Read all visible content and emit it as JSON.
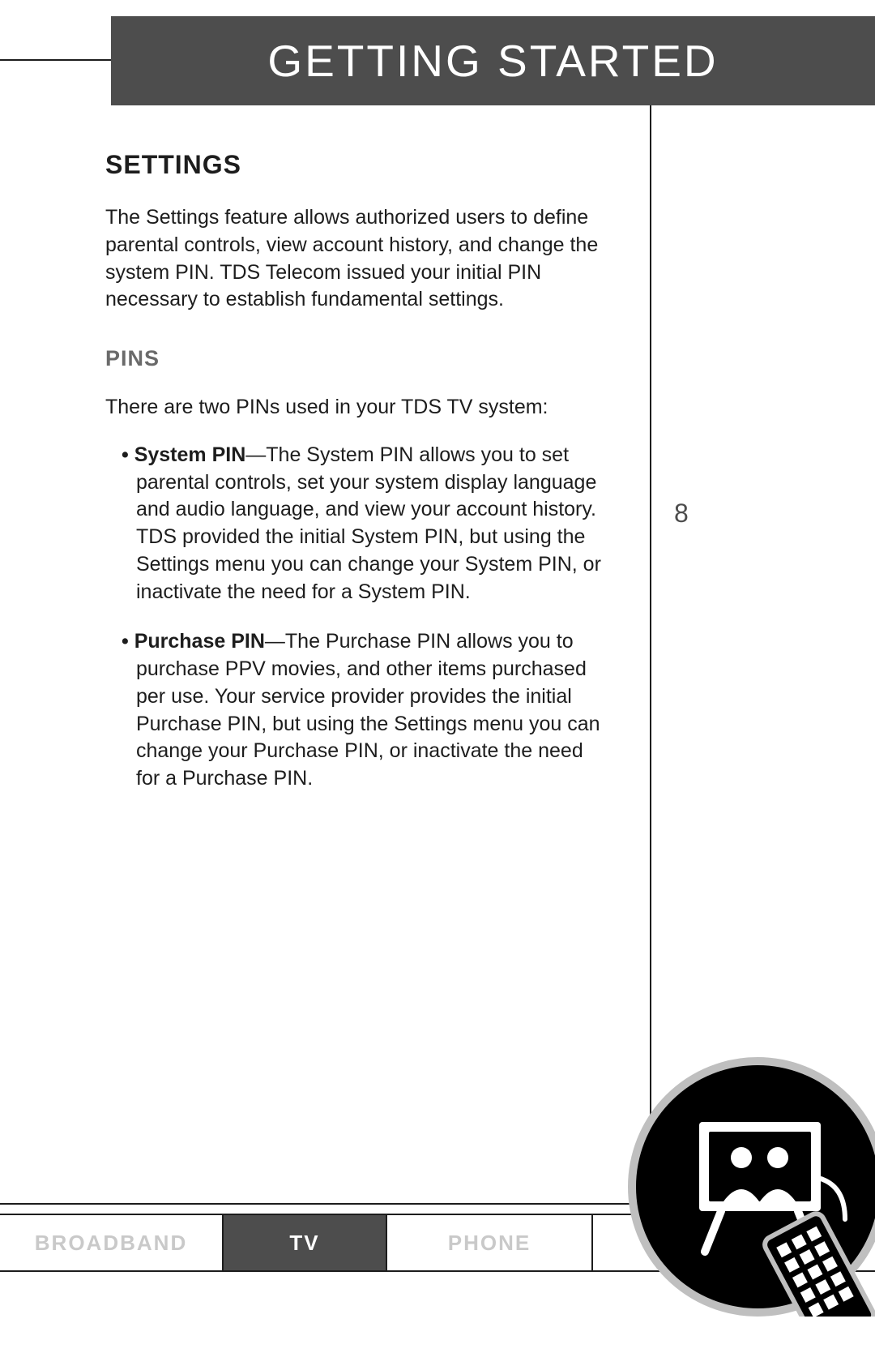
{
  "header": {
    "title": "GETTING STARTED"
  },
  "page_number": "8",
  "content": {
    "heading": "SETTINGS",
    "intro": "The Settings feature allows authorized users to define parental controls, view account history, and change the system PIN. TDS Telecom issued your initial PIN necessary to establish fundamental settings.",
    "pins": {
      "heading": "PINS",
      "lead": "There are two PINs used in your TDS TV system:",
      "items": [
        {
          "label": "System PIN",
          "text": "—The System PIN allows you to set parental controls, set your system display language and audio language, and view your account history. TDS provided the initial System PIN, but using the Settings menu you can change your System PIN, or inactivate the need for a System PIN."
        },
        {
          "label": "Purchase PIN",
          "text": "—The Purchase PIN allows you to purchase PPV movies, and other items purchased per use. Your service provider provides the initial Purchase PIN, but using the Settings menu you can change your Purchase PIN, or inactivate the need for a Purchase PIN."
        }
      ]
    }
  },
  "footer": {
    "tabs": {
      "broadband": "BROADBAND",
      "tv": "TV",
      "phone": "PHONE"
    }
  }
}
